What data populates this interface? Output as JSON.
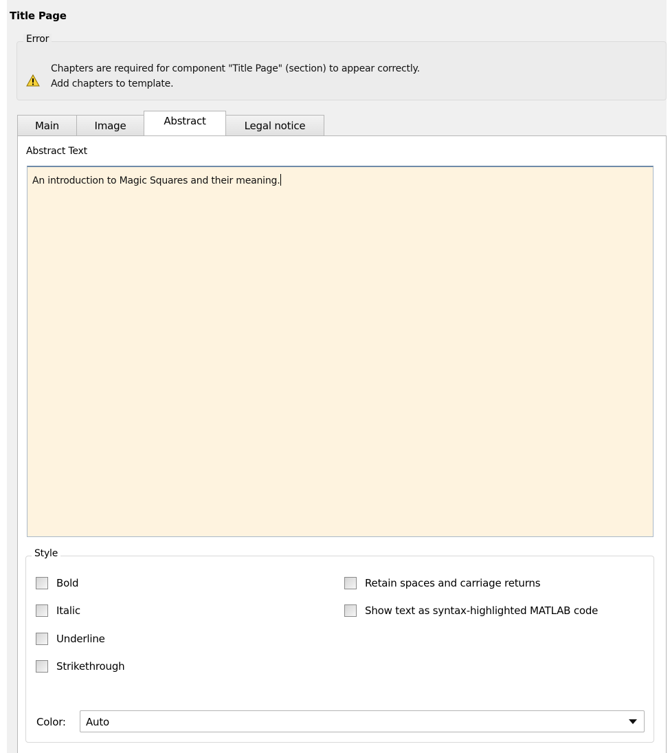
{
  "page_title": "Title Page",
  "error": {
    "legend": "Error",
    "icon": "warning-icon",
    "lines": [
      "Chapters are required for component \"Title Page\" (section) to appear correctly.",
      "Add chapters to template."
    ]
  },
  "tabs": [
    {
      "label": "Main",
      "active": false
    },
    {
      "label": "Image",
      "active": false
    },
    {
      "label": "Abstract",
      "active": true
    },
    {
      "label": "Legal notice",
      "active": false
    }
  ],
  "abstract": {
    "label": "Abstract Text",
    "value": "An introduction to Magic Squares and their meaning.",
    "background": "#fef3df"
  },
  "style": {
    "legend": "Style",
    "options": [
      {
        "label": "Bold",
        "checked": false
      },
      {
        "label": "Italic",
        "checked": false
      },
      {
        "label": "Underline",
        "checked": false
      },
      {
        "label": "Strikethrough",
        "checked": false
      },
      {
        "label": "Retain spaces and carriage returns",
        "checked": false
      },
      {
        "label": "Show text as syntax-highlighted MATLAB code",
        "checked": false
      }
    ],
    "color_label": "Color:",
    "color_value": "Auto"
  }
}
